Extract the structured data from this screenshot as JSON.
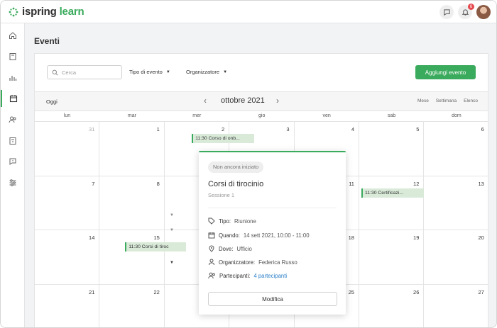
{
  "app": {
    "logo": "ispring",
    "logo_accent": "learn",
    "brand_color": "#3aaa5c"
  },
  "header": {
    "notifications_count": "6"
  },
  "sidebar": {
    "items": [
      {
        "icon": "home-icon"
      },
      {
        "icon": "book-icon"
      },
      {
        "icon": "chart-icon"
      },
      {
        "icon": "calendar-icon",
        "active": true
      },
      {
        "icon": "users-icon"
      },
      {
        "icon": "certificate-icon"
      },
      {
        "icon": "question-icon"
      },
      {
        "icon": "sliders-icon"
      }
    ]
  },
  "page": {
    "title": "Eventi"
  },
  "filters": {
    "search_placeholder": "Cerca",
    "event_type": "Tipo di evento",
    "organizer": "Organizzatore",
    "add_button": "Aggiungi evento"
  },
  "calendar": {
    "today": "Oggi",
    "month": "ottobre 2021",
    "views": [
      "Mese",
      "Settimana",
      "Elenco"
    ],
    "weekdays": [
      "lun",
      "mar",
      "mer",
      "gio",
      "ven",
      "sab",
      "dom"
    ],
    "weeks": [
      [
        "31",
        "1",
        "2",
        "3",
        "4",
        "5",
        "6"
      ],
      [
        "7",
        "8",
        "",
        "",
        "11",
        "12",
        "13"
      ],
      [
        "14",
        "15",
        "",
        "",
        "18",
        "19",
        "20"
      ],
      [
        "21",
        "22",
        "",
        "",
        "25",
        "26",
        "27"
      ]
    ],
    "events": [
      {
        "text": "11:30 Corso di onb..."
      },
      {
        "text": "11:30 Certificazi..."
      },
      {
        "text": "11:30 Corsi di tiroc"
      }
    ]
  },
  "popup": {
    "status": "Non ancora iniziato",
    "title": "Corsi di tirocinio",
    "subtitle": "Sessione 1",
    "type_label": "Tipo:",
    "type_value": "Riunione",
    "when_label": "Quando:",
    "when_value": "14 sett 2021, 10:00 - 11:00",
    "where_label": "Dove:",
    "where_value": "Ufficio",
    "organizer_label": "Organizzatore:",
    "organizer_value": "Federica Russo",
    "participants_label": "Partecipanti:",
    "participants_value": "4 partecipanti",
    "edit_button": "Modifica"
  }
}
